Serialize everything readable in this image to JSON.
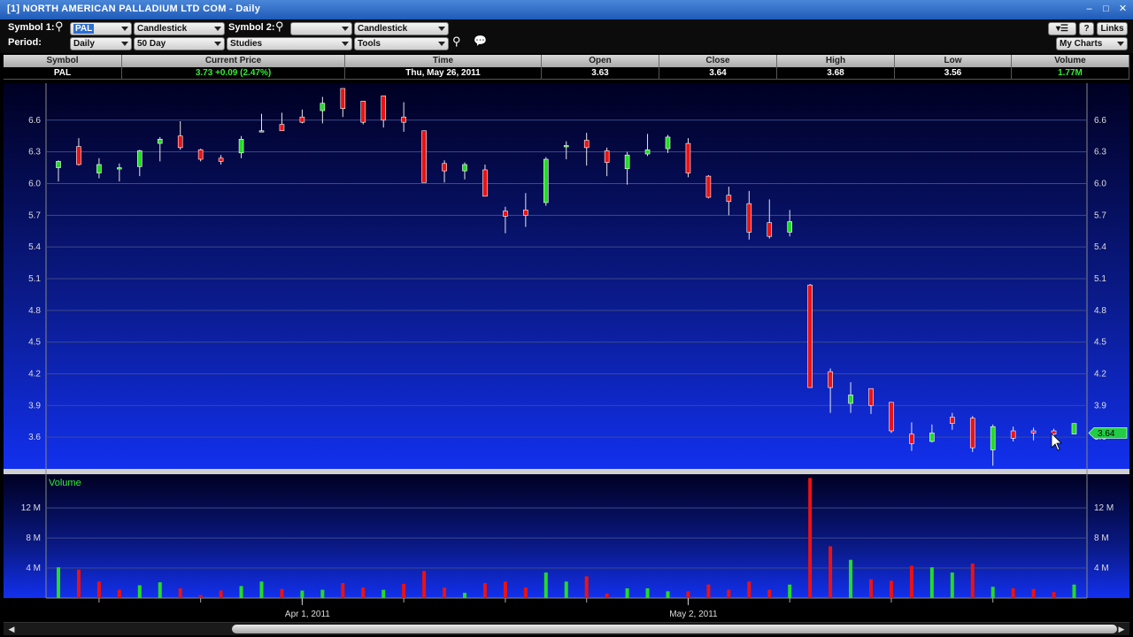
{
  "window": {
    "title": "[1] NORTH AMERICAN PALLADIUM LTD COM - Daily",
    "buttons": [
      "–",
      "□",
      "✕"
    ]
  },
  "toolbar": {
    "symbol1_label": "Symbol 1:",
    "symbol1_value": "PAL",
    "symbol1_type": "Candlestick",
    "symbol2_label": "Symbol 2:",
    "symbol2_value": "",
    "symbol2_type": "Candlestick",
    "period_label": "Period:",
    "period_value": "Daily",
    "range_value": "50 Day",
    "studies_value": "Studies",
    "tools_value": "Tools",
    "help_label": "?",
    "links_label": "Links",
    "my_charts_value": "My Charts",
    "menu_icon": "list-menu-icon",
    "search_icon": "magnifier-icon",
    "zoom_icon": "zoom-icon",
    "chat_icon": "chat-bubble-icon"
  },
  "quote": {
    "headers": [
      "Symbol",
      "Current Price",
      "Time",
      "Open",
      "Close",
      "High",
      "Low",
      "Volume"
    ],
    "symbol": "PAL",
    "current_price": "3.73  +0.09 (2.47%)",
    "time": "Thu, May 26, 2011",
    "open": "3.63",
    "close": "3.64",
    "high": "3.68",
    "low": "3.56",
    "volume": "1.77M"
  },
  "colors": {
    "up": "#22dd22",
    "down": "#ee1111",
    "price_up_text": "#33ee33",
    "current_marker": "#22cc44"
  },
  "chart_data": [
    {
      "type": "candlestick",
      "ylim": [
        3.3,
        6.95
      ],
      "yticks": [
        "6.6",
        "6.3",
        "6.0",
        "5.7",
        "5.4",
        "5.1",
        "4.8",
        "4.5",
        "4.2",
        "3.9",
        "3.6"
      ],
      "xticks": [
        "Apr 1, 2011",
        "May 2, 2011"
      ],
      "current_value_label": "3.64",
      "candles": [
        {
          "o": 6.15,
          "h": 6.22,
          "l": 6.02,
          "c": 6.21
        },
        {
          "o": 6.35,
          "h": 6.43,
          "l": 6.17,
          "c": 6.18
        },
        {
          "o": 6.1,
          "h": 6.24,
          "l": 6.05,
          "c": 6.18
        },
        {
          "o": 6.14,
          "h": 6.19,
          "l": 6.02,
          "c": 6.15
        },
        {
          "o": 6.16,
          "h": 6.32,
          "l": 6.07,
          "c": 6.31
        },
        {
          "o": 6.38,
          "h": 6.44,
          "l": 6.21,
          "c": 6.42
        },
        {
          "o": 6.45,
          "h": 6.59,
          "l": 6.32,
          "c": 6.34
        },
        {
          "o": 6.32,
          "h": 6.33,
          "l": 6.21,
          "c": 6.23
        },
        {
          "o": 6.24,
          "h": 6.27,
          "l": 6.18,
          "c": 6.21
        },
        {
          "o": 6.29,
          "h": 6.45,
          "l": 6.24,
          "c": 6.42
        },
        {
          "o": 6.49,
          "h": 6.66,
          "l": 6.49,
          "c": 6.5
        },
        {
          "o": 6.56,
          "h": 6.67,
          "l": 6.5,
          "c": 6.5
        },
        {
          "o": 6.63,
          "h": 6.7,
          "l": 6.57,
          "c": 6.58
        },
        {
          "o": 6.69,
          "h": 6.82,
          "l": 6.57,
          "c": 6.76
        },
        {
          "o": 6.9,
          "h": 6.9,
          "l": 6.63,
          "c": 6.71
        },
        {
          "o": 6.78,
          "h": 6.78,
          "l": 6.56,
          "c": 6.58
        },
        {
          "o": 6.83,
          "h": 6.83,
          "l": 6.53,
          "c": 6.6
        },
        {
          "o": 6.63,
          "h": 6.77,
          "l": 6.49,
          "c": 6.58
        },
        {
          "o": 6.5,
          "h": 6.5,
          "l": 6.01,
          "c": 6.01
        },
        {
          "o": 6.19,
          "h": 6.22,
          "l": 6.01,
          "c": 6.12
        },
        {
          "o": 6.12,
          "h": 6.2,
          "l": 6.04,
          "c": 6.18
        },
        {
          "o": 6.13,
          "h": 6.18,
          "l": 5.89,
          "c": 5.88
        },
        {
          "o": 5.74,
          "h": 5.78,
          "l": 5.53,
          "c": 5.69
        },
        {
          "o": 5.75,
          "h": 5.91,
          "l": 5.59,
          "c": 5.7
        },
        {
          "o": 5.82,
          "h": 6.25,
          "l": 5.79,
          "c": 6.23
        },
        {
          "o": 6.36,
          "h": 6.4,
          "l": 6.23,
          "c": 6.36
        },
        {
          "o": 6.41,
          "h": 6.48,
          "l": 6.17,
          "c": 6.34
        },
        {
          "o": 6.31,
          "h": 6.34,
          "l": 6.07,
          "c": 6.2
        },
        {
          "o": 6.14,
          "h": 6.3,
          "l": 5.99,
          "c": 6.27
        },
        {
          "o": 6.28,
          "h": 6.47,
          "l": 6.26,
          "c": 6.32
        },
        {
          "o": 6.33,
          "h": 6.46,
          "l": 6.29,
          "c": 6.44
        },
        {
          "o": 6.38,
          "h": 6.43,
          "l": 6.06,
          "c": 6.1
        },
        {
          "o": 6.07,
          "h": 6.08,
          "l": 5.86,
          "c": 5.87
        },
        {
          "o": 5.89,
          "h": 5.97,
          "l": 5.7,
          "c": 5.83
        },
        {
          "o": 5.81,
          "h": 5.93,
          "l": 5.47,
          "c": 5.54
        },
        {
          "o": 5.63,
          "h": 5.85,
          "l": 5.48,
          "c": 5.5
        },
        {
          "o": 5.54,
          "h": 5.75,
          "l": 5.5,
          "c": 5.64
        },
        {
          "o": 5.04,
          "h": 5.05,
          "l": 4.09,
          "c": 4.07
        },
        {
          "o": 4.22,
          "h": 4.25,
          "l": 3.83,
          "c": 4.07
        },
        {
          "o": 3.92,
          "h": 4.12,
          "l": 3.83,
          "c": 4.0
        },
        {
          "o": 4.06,
          "h": 4.06,
          "l": 3.82,
          "c": 3.9
        },
        {
          "o": 3.93,
          "h": 3.93,
          "l": 3.64,
          "c": 3.66
        },
        {
          "o": 3.63,
          "h": 3.74,
          "l": 3.47,
          "c": 3.54
        },
        {
          "o": 3.56,
          "h": 3.72,
          "l": 3.55,
          "c": 3.64
        },
        {
          "o": 3.79,
          "h": 3.83,
          "l": 3.67,
          "c": 3.73
        },
        {
          "o": 3.78,
          "h": 3.8,
          "l": 3.46,
          "c": 3.5
        },
        {
          "o": 3.48,
          "h": 3.72,
          "l": 3.33,
          "c": 3.7
        },
        {
          "o": 3.66,
          "h": 3.7,
          "l": 3.56,
          "c": 3.59
        },
        {
          "o": 3.66,
          "h": 3.69,
          "l": 3.57,
          "c": 3.64
        },
        {
          "o": 3.66,
          "h": 3.68,
          "l": 3.58,
          "c": 3.63
        },
        {
          "o": 3.63,
          "h": 3.73,
          "l": 3.63,
          "c": 3.73
        }
      ]
    },
    {
      "type": "bar",
      "title": "Volume",
      "ylim": [
        0,
        16.5
      ],
      "yticks": [
        "12 M",
        "8 M",
        "4 M"
      ],
      "ytick_values": [
        12,
        8,
        4
      ],
      "values": [
        4.1,
        3.8,
        2.2,
        1.1,
        1.7,
        2.1,
        1.3,
        0.4,
        1.0,
        1.6,
        2.2,
        1.2,
        1.0,
        1.1,
        2.0,
        1.4,
        1.1,
        1.9,
        3.6,
        1.4,
        0.7,
        2.0,
        2.2,
        1.4,
        3.4,
        2.2,
        2.9,
        0.6,
        1.3,
        1.3,
        0.9,
        0.9,
        1.8,
        1.1,
        2.2,
        1.1,
        1.8,
        16.0,
        6.9,
        5.1,
        2.5,
        2.3,
        4.3,
        4.1,
        3.4,
        4.6,
        1.5,
        1.3,
        1.2,
        0.8,
        1.8
      ],
      "up": [
        true,
        false,
        false,
        false,
        true,
        true,
        false,
        false,
        false,
        true,
        true,
        false,
        true,
        true,
        false,
        false,
        true,
        false,
        false,
        false,
        true,
        false,
        false,
        false,
        true,
        true,
        false,
        false,
        true,
        true,
        true,
        false,
        false,
        false,
        false,
        false,
        true,
        false,
        false,
        true,
        false,
        false,
        false,
        true,
        true,
        false,
        true,
        false,
        false,
        false,
        true
      ]
    }
  ]
}
